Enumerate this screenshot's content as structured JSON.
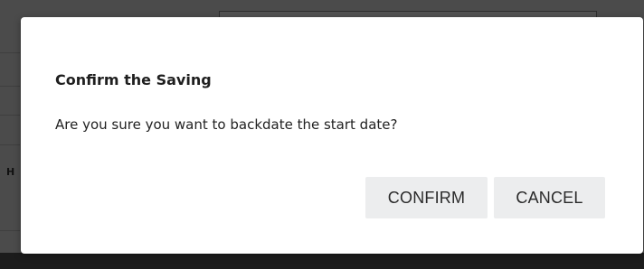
{
  "dialog": {
    "title": "Confirm the Saving",
    "message": "Are you sure you want to backdate the start date?",
    "confirm_label": "CONFIRM",
    "cancel_label": "CANCEL"
  },
  "background": {
    "partial_letter": "H"
  },
  "colors": {
    "overlay": "#4b4b4b",
    "dialog_bg": "#ffffff",
    "button_bg": "#ecedee",
    "text": "#222222"
  }
}
